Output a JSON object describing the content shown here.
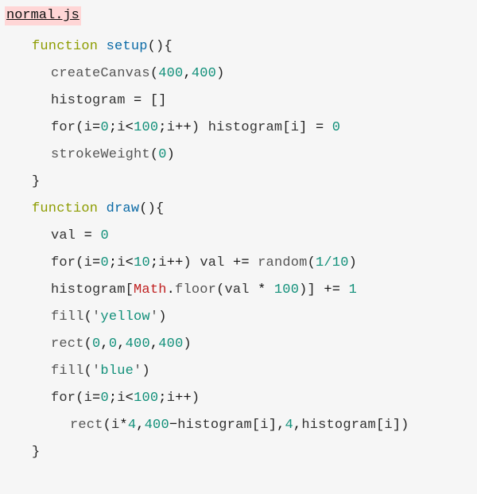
{
  "file": {
    "name": "normal.js"
  },
  "code": {
    "kw_function": "function",
    "fn_setup": "setup",
    "fn_draw": "draw",
    "call_createCanvas": "createCanvas",
    "call_strokeWeight": "strokeWeight",
    "call_fill": "fill",
    "call_rect": "rect",
    "call_random": "random",
    "call_floor": "floor",
    "prop_Math": "Math",
    "id_histogram": "histogram",
    "id_for": "for",
    "id_i": "i",
    "id_val": "val",
    "str_yellow": "yellow",
    "str_blue": "blue",
    "num_0": "0",
    "num_1": "1",
    "num_4": "4",
    "num_10": "10",
    "num_100": "100",
    "num_400": "400",
    "frac_1_10": "1/10"
  }
}
